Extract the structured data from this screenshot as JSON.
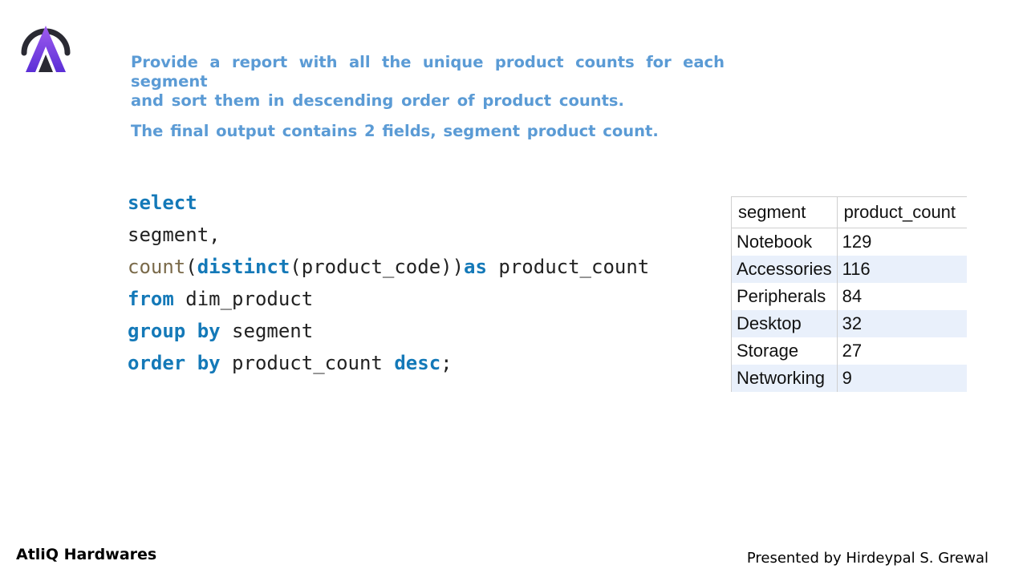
{
  "prompt": {
    "line1": "Provide a report with all the unique product counts for each segment",
    "line2": "and sort them in descending order of product counts.",
    "line3": "The final output contains 2 fields, segment product count."
  },
  "code": {
    "l1_kw": "select",
    "l2": "segment,",
    "l3_fn": "count",
    "l3_p1": "(",
    "l3_kw1": "distinct",
    "l3_rest": "(product_code))",
    "l3_kw2": "as",
    "l3_tail": " product_count",
    "l4_kw": "from",
    "l4_rest": " dim_product",
    "l5_kw": "group by",
    "l5_rest": " segment",
    "l6_kw1": "order by",
    "l6_mid": " product_count ",
    "l6_kw2": "desc",
    "l6_end": ";"
  },
  "result": {
    "headers": [
      "segment",
      "product_count"
    ],
    "rows": [
      [
        "Notebook",
        "129"
      ],
      [
        "Accessories",
        "116"
      ],
      [
        "Peripherals",
        "84"
      ],
      [
        "Desktop",
        "32"
      ],
      [
        "Storage",
        "27"
      ],
      [
        "Networking",
        "9"
      ]
    ]
  },
  "footer": {
    "left": "AtliQ Hardwares",
    "right": "Presented by Hirdeypal S. Grewal"
  },
  "colors": {
    "prompt_text": "#5b9bd5",
    "keyword": "#1479b8",
    "alt_row": "#e9f0fb",
    "logo_purple": "#7b3fe4"
  },
  "icons": [
    "atliq-logo-icon"
  ]
}
